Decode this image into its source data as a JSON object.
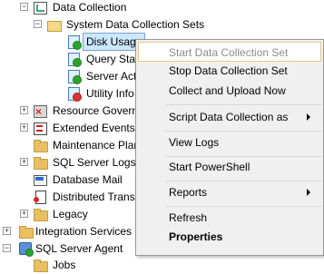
{
  "tree": {
    "data_collection": "Data Collection",
    "system_sets": "System Data Collection Sets",
    "disk_usage": "Disk Usage",
    "query_stats": "Query Stat",
    "server_activity": "Server Act",
    "utility_info": "Utility Info",
    "resource_governor": "Resource Governo",
    "extended_events": "Extended Events",
    "maintenance_plans": "Maintenance Plan",
    "sql_server_logs": "SQL Server Logs",
    "database_mail": "Database Mail",
    "distributed_trans": "Distributed Trans",
    "legacy": "Legacy",
    "integration_services": "Integration Services C",
    "sql_server_agent": "SQL Server Agent",
    "jobs": "Jobs"
  },
  "menu": {
    "items": [
      {
        "label": "Start Data Collection Set",
        "disabled": true
      },
      {
        "label": "Stop Data Collection Set"
      },
      {
        "label": "Collect and Upload Now"
      },
      {
        "label": "Script Data Collection as",
        "submenu": true
      },
      {
        "label": "View Logs"
      },
      {
        "label": "Start PowerShell"
      },
      {
        "label": "Reports",
        "submenu": true
      },
      {
        "label": "Refresh"
      },
      {
        "label": "Properties",
        "bold": true
      }
    ]
  },
  "colors": {
    "selection_bg": "#cce8ff",
    "menu_bg": "#f0f0f0",
    "menu_highlight_border": "#e6c88b",
    "disabled_text": "#8b8b8b"
  }
}
